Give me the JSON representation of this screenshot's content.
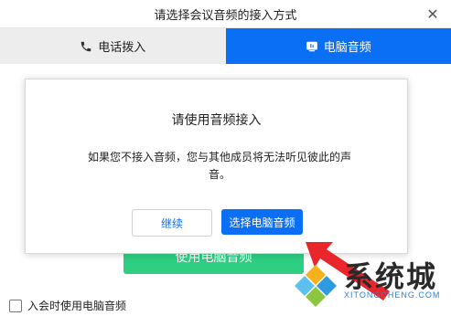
{
  "window": {
    "title": "请选择会议音频的接入方式",
    "close_glyph": "✕"
  },
  "tabs": [
    {
      "label": "电话拨入",
      "icon": "phone-icon",
      "active": false
    },
    {
      "label": "电脑音频",
      "icon": "computer-audio-icon",
      "active": true
    }
  ],
  "main": {
    "use_computer_audio_label": "使用电脑音频",
    "auto_join_checkbox_label": "入会时使用电脑音频",
    "auto_join_checked": false
  },
  "modal": {
    "title": "请使用音频接入",
    "message_line1": "如果您不接入音频，您与其他成员将无法听见彼此的声",
    "message_line2": "音。",
    "continue_label": "继续",
    "select_label": "选择电脑音频"
  },
  "watermark": {
    "brand_text": "系统城",
    "sub_text": "XITONGCHENG.COM",
    "logo": "windows-logo"
  },
  "colors": {
    "accent_blue": "#0b6ff5",
    "green": "#2ecf82",
    "arrow_red": "#e8262b"
  }
}
